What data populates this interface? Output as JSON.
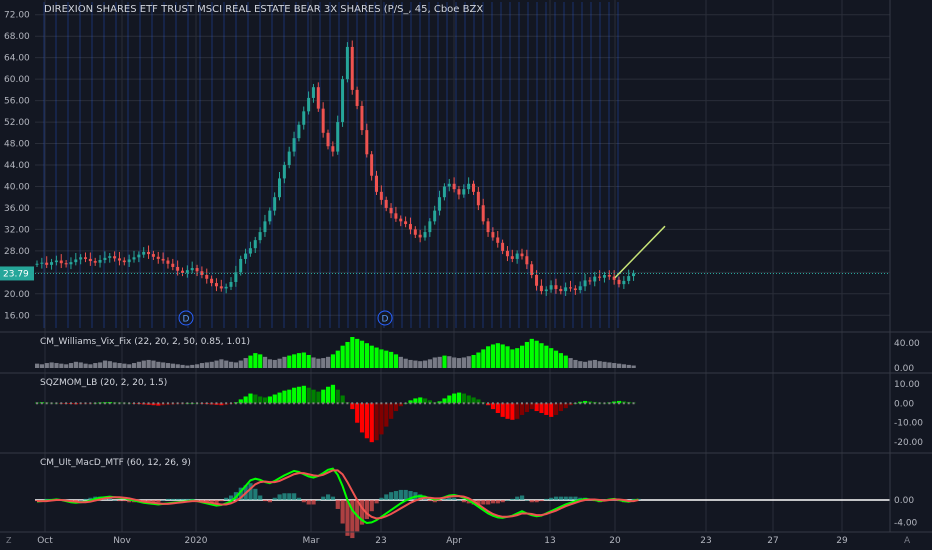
{
  "header": {
    "title": "DIREXION SHARES ETF TRUST MSCI REAL ESTATE BEAR 3X SHARES (P/S_, 45, Cboe BZX"
  },
  "colors": {
    "background": "#131722",
    "grid": "#2a2e39",
    "text": "#b2b5be",
    "up": "#26a69a",
    "down": "#ef5350",
    "lime": "#00ff00",
    "vline": "#2962ff",
    "price_badge": "#26a69a",
    "trend_line": "#c6e377"
  },
  "time_axis": {
    "labels": [
      "Oct",
      "Nov",
      "2020",
      "Mar",
      "23",
      "Apr",
      "13",
      "20",
      "23",
      "27",
      "29"
    ]
  },
  "bottom_bar": {
    "left_icon_label": "Z",
    "right_icon_label": "A"
  },
  "chart_data": [
    {
      "type": "candlestick",
      "title": "DIREXION SHARES ETF TRUST MSCI REAL ESTATE BEAR 3X SHARES (P/S_, 45, Cboe BZX",
      "ylim": [
        14,
        74
      ],
      "yticks": [
        16,
        20,
        24,
        28,
        32,
        36,
        40,
        44,
        48,
        52,
        56,
        60,
        64,
        68,
        72
      ],
      "ytick_labels": [
        "16.00",
        "20.00",
        "",
        "28.00",
        "32.00",
        "36.00",
        "40.00",
        "44.00",
        "48.00",
        "52.00",
        "56.00",
        "60.00",
        "64.00",
        "68.00",
        "72.00"
      ],
      "last_price": 23.79,
      "last_price_label": "23.79",
      "event_markers": [
        {
          "label": "D",
          "time": "2020"
        },
        {
          "label": "D",
          "time": "23"
        }
      ],
      "close_series": [
        25.6,
        25.8,
        25.4,
        25.9,
        26.2,
        25.7,
        25.5,
        25.9,
        26.4,
        26.8,
        26.5,
        26.1,
        25.8,
        26.3,
        26.7,
        27.0,
        26.6,
        26.2,
        25.9,
        26.4,
        26.8,
        27.3,
        27.8,
        27.4,
        26.9,
        26.5,
        26.2,
        25.6,
        25.0,
        24.3,
        23.9,
        24.4,
        24.8,
        24.2,
        23.5,
        22.8,
        22.0,
        21.4,
        21.0,
        21.3,
        22.2,
        24.0,
        26.5,
        27.5,
        28.5,
        30.0,
        31.5,
        33.5,
        35.5,
        38.0,
        41.5,
        44.0,
        46.5,
        49.0,
        51.5,
        54.0,
        56.5,
        58.5,
        54.5,
        50.0,
        47.5,
        46.5,
        52.0,
        60.0,
        66.0,
        58.0,
        55.0,
        50.5,
        46.0,
        42.0,
        39.0,
        37.5,
        36.0,
        35.0,
        34.0,
        33.5,
        33.0,
        32.0,
        31.0,
        30.5,
        31.5,
        33.5,
        35.5,
        38.0,
        40.0,
        40.5,
        39.5,
        38.5,
        39.5,
        40.5,
        39.0,
        36.5,
        33.5,
        31.5,
        30.5,
        29.5,
        28.0,
        27.0,
        26.5,
        27.5,
        27.0,
        25.5,
        23.5,
        21.5,
        20.5,
        20.8,
        21.6,
        20.9,
        20.5,
        21.2,
        21.0,
        20.7,
        21.4,
        22.5,
        22.3,
        23.2,
        23.0,
        23.5,
        23.2,
        22.6,
        21.8,
        22.4,
        23.3,
        23.79
      ],
      "trend_line": {
        "from": [
          "20",
          23.0
        ],
        "to": [
          "27",
          32.6
        ]
      }
    },
    {
      "type": "bar",
      "title": "CM_Williams_Vix_Fix (22, 20, 2, 50, 0.85, 1.01)",
      "ylim": [
        0,
        50
      ],
      "yticks": [
        0,
        40
      ],
      "ytick_labels": [
        "0.00",
        "40.00"
      ],
      "values": [
        7,
        6,
        8,
        9,
        8,
        7,
        6,
        8,
        10,
        9,
        7,
        6,
        8,
        9,
        12,
        11,
        9,
        8,
        7,
        6,
        8,
        10,
        12,
        13,
        12,
        10,
        9,
        8,
        7,
        6,
        5,
        4,
        5,
        6,
        8,
        9,
        10,
        12,
        14,
        12,
        10,
        9,
        12,
        16,
        20,
        24,
        22,
        18,
        14,
        13,
        15,
        18,
        20,
        22,
        24,
        25,
        21,
        17,
        15,
        16,
        18,
        22,
        28,
        36,
        42,
        50,
        47,
        44,
        40,
        36,
        33,
        30,
        28,
        26,
        22,
        18,
        15,
        13,
        12,
        11,
        12,
        14,
        17,
        18,
        20,
        19,
        17,
        16,
        17,
        19,
        21,
        25,
        30,
        35,
        38,
        40,
        38,
        35,
        30,
        32,
        36,
        42,
        47,
        44,
        40,
        36,
        32,
        28,
        24,
        20,
        16,
        13,
        11,
        10,
        12,
        13,
        11,
        10,
        9,
        8,
        7,
        6,
        5,
        4
      ]
    },
    {
      "type": "bar",
      "title": "SQZMOM_LB (20, 2, 20, 1.5)",
      "ylim": [
        -23,
        13
      ],
      "yticks": [
        -20,
        -10,
        0,
        10
      ],
      "ytick_labels": [
        "-20.00",
        "-10.00",
        "0.00",
        "10.00"
      ],
      "values": [
        0.3,
        0.5,
        0.4,
        0.2,
        0,
        -0.2,
        -0.3,
        -0.4,
        -0.5,
        -0.4,
        -0.3,
        -0.1,
        0.2,
        0.4,
        0.5,
        0.6,
        0.5,
        0.4,
        0.3,
        0.1,
        -0.2,
        -0.4,
        -0.6,
        -0.8,
        -1,
        -1.2,
        -1,
        -0.8,
        -0.6,
        -0.4,
        -0.2,
        0,
        0.1,
        0,
        -0.2,
        -0.4,
        -0.6,
        -0.8,
        -1,
        -0.8,
        -0.4,
        0.5,
        2,
        3.5,
        5,
        4.5,
        3.5,
        3,
        3.5,
        4.5,
        5.5,
        6.5,
        7,
        8,
        8.5,
        9,
        8,
        7,
        6,
        7,
        8.5,
        9.5,
        7,
        4,
        0.5,
        -3,
        -10,
        -15,
        -18,
        -20,
        -19,
        -16,
        -12,
        -8,
        -4,
        -1.5,
        0,
        1.5,
        2.5,
        3,
        2.5,
        1.5,
        0.5,
        1,
        2.5,
        4,
        5,
        5.5,
        5,
        4,
        3,
        2,
        0.5,
        -1,
        -3,
        -5,
        -7,
        -8,
        -8.5,
        -8,
        -6,
        -4.5,
        -3,
        -4,
        -5,
        -6,
        -7,
        -6,
        -4,
        -2.5,
        -1,
        0,
        0.8,
        1.2,
        1,
        0.7,
        0.3,
        0,
        0.4,
        0.9,
        1.2,
        1,
        0.7,
        0.4
      ]
    },
    {
      "type": "line",
      "title": "CM_Ult_MacD_MTF (60, 12, 26, 9)",
      "ylim": [
        -5,
        7.5
      ],
      "yticks": [
        -4,
        -2,
        0,
        2,
        4,
        6
      ],
      "ytick_labels": [
        "-4.00",
        "",
        "0.00",
        "",
        "",
        ""
      ],
      "series": [
        {
          "color": "lime",
          "values": [
            -0.3,
            -0.2,
            -0.1,
            0,
            0.1,
            0,
            -0.2,
            -0.4,
            -0.5,
            -0.4,
            -0.3,
            -0.1,
            0.2,
            0.4,
            0.5,
            0.6,
            0.5,
            0.4,
            0.3,
            0.1,
            -0.1,
            -0.3,
            -0.5,
            -0.6,
            -0.7,
            -0.8,
            -0.7,
            -0.6,
            -0.5,
            -0.4,
            -0.3,
            -0.2,
            -0.1,
            -0.2,
            -0.4,
            -0.6,
            -0.8,
            -1.0,
            -0.9,
            -0.6,
            -0.2,
            0.5,
            1.5,
            2.5,
            3.5,
            3.8,
            3.6,
            3.2,
            3.0,
            3.4,
            3.9,
            4.4,
            4.8,
            5.2,
            5.0,
            4.6,
            4.2,
            4.0,
            4.3,
            4.8,
            5.4,
            5.6,
            4.5,
            2.5,
            0,
            -1.8,
            -2.8,
            -3.6,
            -4.1,
            -4.0,
            -3.6,
            -3.0,
            -2.4,
            -1.8,
            -1.2,
            -0.6,
            -0.1,
            0.3,
            0.6,
            0.7,
            0.6,
            0.3,
            0.1,
            0.2,
            0.5,
            0.8,
            0.9,
            0.7,
            0.4,
            0,
            -0.6,
            -1.2,
            -1.8,
            -2.4,
            -2.8,
            -3.1,
            -3.2,
            -3.0,
            -2.8,
            -2.4,
            -2.0,
            -2.4,
            -2.7,
            -2.9,
            -2.8,
            -2.4,
            -2.0,
            -1.6,
            -1.2,
            -0.8,
            -0.5,
            -0.2,
            0,
            0.2,
            0.1,
            0,
            -0.2,
            -0.1,
            0.1,
            0.2,
            0,
            -0.2,
            -0.3,
            -0.1,
            0.1
          ]
        },
        {
          "color": "down",
          "values": [
            -0.2,
            -0.2,
            -0.2,
            -0.1,
            0,
            0,
            -0.1,
            -0.2,
            -0.3,
            -0.4,
            -0.4,
            -0.3,
            -0.1,
            0.1,
            0.3,
            0.4,
            0.5,
            0.5,
            0.4,
            0.3,
            0.1,
            -0.1,
            -0.3,
            -0.4,
            -0.5,
            -0.6,
            -0.7,
            -0.7,
            -0.6,
            -0.5,
            -0.4,
            -0.3,
            -0.2,
            -0.2,
            -0.3,
            -0.4,
            -0.5,
            -0.7,
            -0.8,
            -0.8,
            -0.6,
            -0.2,
            0.4,
            1.2,
            2.0,
            2.8,
            3.2,
            3.3,
            3.2,
            3.2,
            3.4,
            3.8,
            4.2,
            4.6,
            4.8,
            4.8,
            4.6,
            4.4,
            4.3,
            4.5,
            4.9,
            5.3,
            5.3,
            4.6,
            3.2,
            1.6,
            0,
            -1.4,
            -2.4,
            -3.0,
            -3.3,
            -3.2,
            -2.9,
            -2.5,
            -2.0,
            -1.5,
            -1.0,
            -0.5,
            -0.1,
            0.2,
            0.4,
            0.4,
            0.3,
            0.3,
            0.4,
            0.6,
            0.7,
            0.7,
            0.6,
            0.3,
            -0.2,
            -0.8,
            -1.4,
            -2.0,
            -2.5,
            -2.8,
            -3.0,
            -3.0,
            -2.9,
            -2.7,
            -2.4,
            -2.4,
            -2.5,
            -2.7,
            -2.7,
            -2.5,
            -2.2,
            -1.9,
            -1.5,
            -1.1,
            -0.8,
            -0.5,
            -0.2,
            0,
            0.1,
            0.1,
            0,
            -0.1,
            0,
            0.1,
            0.1,
            0,
            -0.2,
            -0.2,
            0
          ]
        }
      ],
      "zero_line": 0
    }
  ]
}
